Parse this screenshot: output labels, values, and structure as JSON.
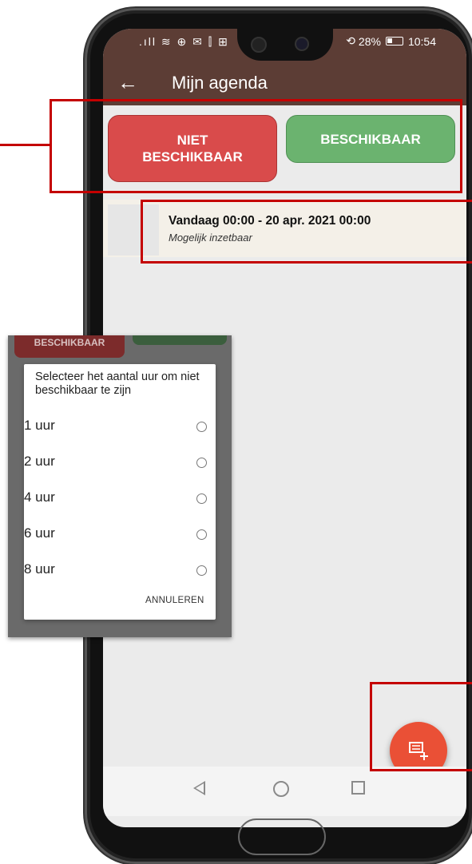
{
  "statusbar": {
    "left_icons": ".ıll ≋ ⊕ ✉ ⫿ ⊞",
    "battery_text": "28%",
    "time": "10:54",
    "speed_icon": "⟲"
  },
  "appbar": {
    "title": "Mijn agenda"
  },
  "buttons": {
    "not_available_line1": "NIET",
    "not_available_line2": "BESCHIKBAAR",
    "available": "BESCHIKBAAR"
  },
  "event": {
    "title": "Vandaag 00:00 - 20 apr. 2021 00:00",
    "subtitle": "Mogelijk inzetbaar"
  },
  "dialog": {
    "behind_red_label": "BESCHIKBAAR",
    "title": "Selecteer het aantal uur om niet beschikbaar te zijn",
    "options": [
      "1 uur",
      "2 uur",
      "4 uur",
      "6 uur",
      "8 uur"
    ],
    "cancel": "ANNULEREN"
  },
  "colors": {
    "appbar": "#5c3d35",
    "red_button": "#d94b4b",
    "green_button": "#6bb36f",
    "fab": "#ea5036",
    "highlight": "#c40000"
  }
}
